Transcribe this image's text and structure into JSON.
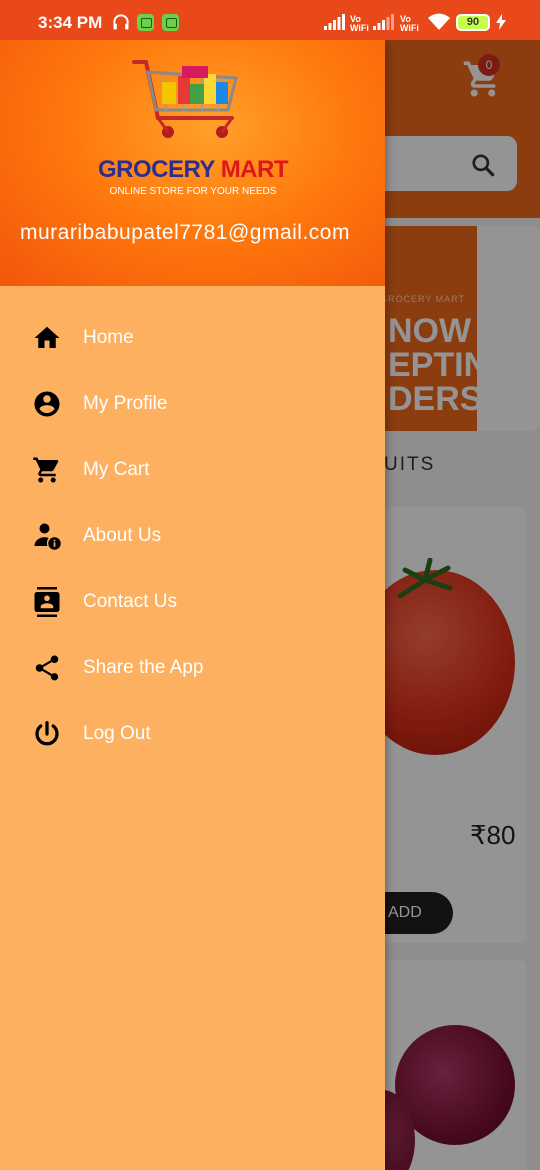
{
  "status_bar": {
    "time": "3:34 PM",
    "vowifi_1": "Vo WiFi",
    "vowifi_2": "Vo WiFi",
    "battery": "90"
  },
  "background": {
    "cart_count": "0",
    "banner_small": "GROCERY MART",
    "banner_lines": [
      "NOW",
      "EPTING",
      "DERS"
    ],
    "section_title": "UITS",
    "price": "₹80",
    "add_label": "ADD"
  },
  "drawer": {
    "logo": {
      "title_part1": "GROCERY",
      "title_part2": "MART",
      "tagline": "ONLINE STORE FOR YOUR NEEDS"
    },
    "email": "muraribabupatel7781@gmail.com",
    "menu": [
      {
        "label": "Home",
        "icon": "home-icon"
      },
      {
        "label": "My Profile",
        "icon": "account-circle-icon"
      },
      {
        "label": "My Cart",
        "icon": "shopping-cart-icon"
      },
      {
        "label": "About Us",
        "icon": "person-info-icon"
      },
      {
        "label": "Contact Us",
        "icon": "contacts-icon"
      },
      {
        "label": "Share the App",
        "icon": "share-icon"
      },
      {
        "label": "Log Out",
        "icon": "power-icon"
      }
    ]
  },
  "colors": {
    "status_bar": "#e8481a",
    "drawer_bg": "#fdb05f",
    "header_orange": "#ff7a0d",
    "logo_blue": "#2b2f8f",
    "logo_red": "#e0161a"
  }
}
